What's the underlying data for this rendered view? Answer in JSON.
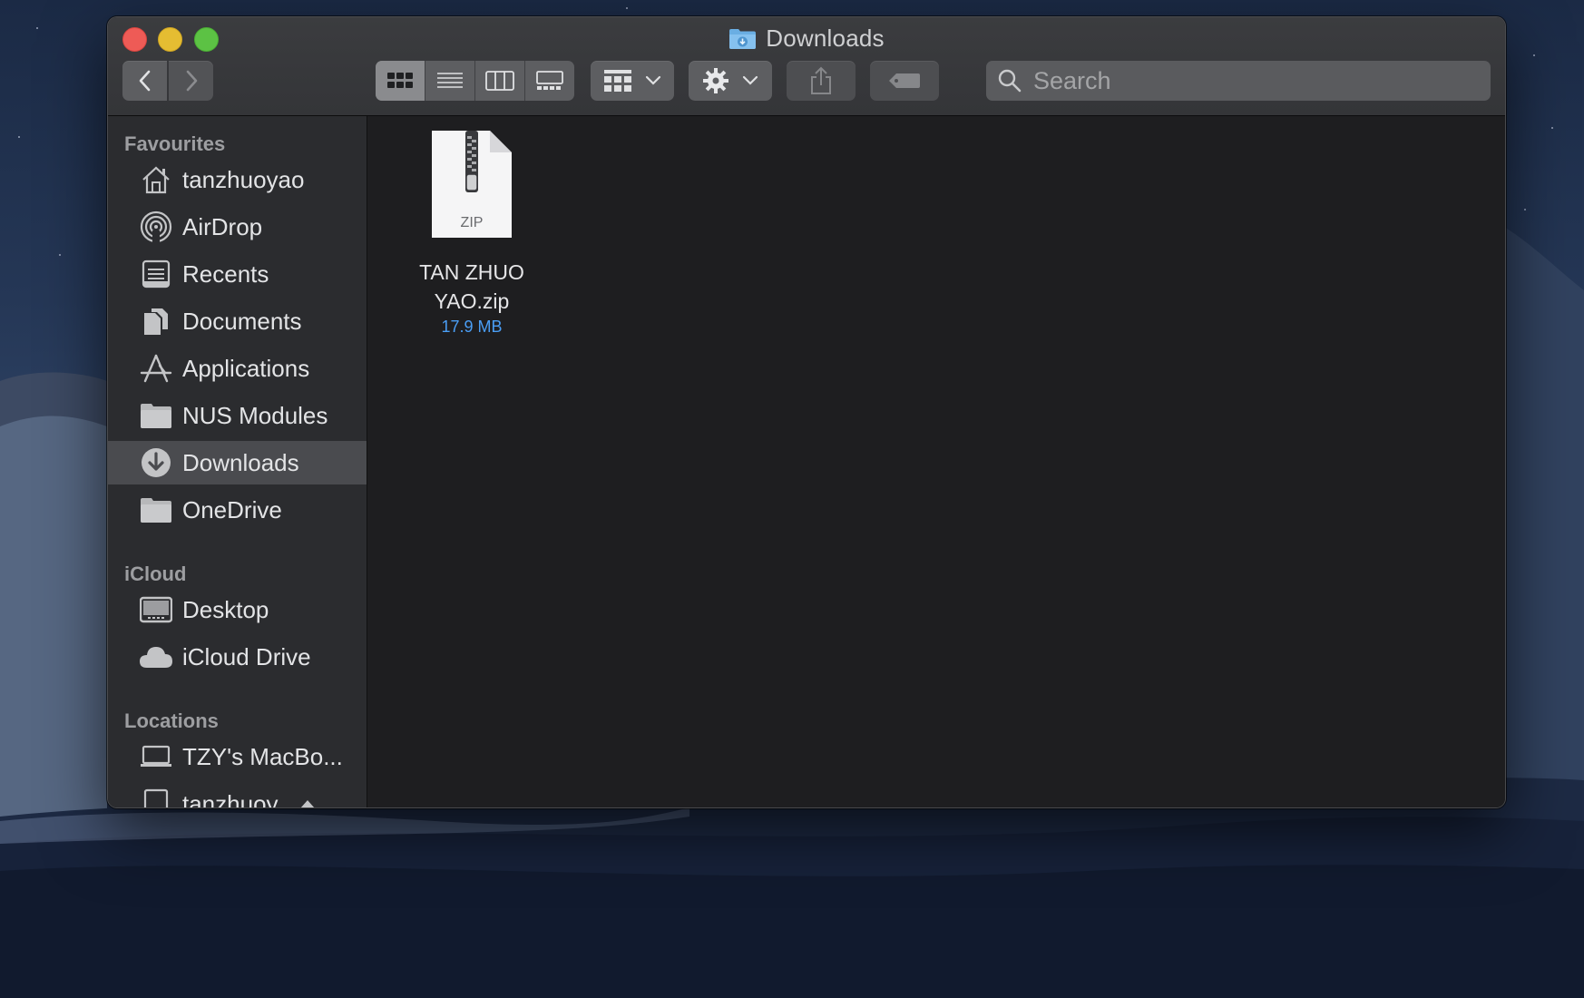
{
  "window": {
    "title": "Downloads"
  },
  "toolbar": {
    "back_label": "Back",
    "forward_label": "Forward",
    "views": [
      "icon-view",
      "list-view",
      "column-view",
      "gallery-view"
    ],
    "active_view": "icon-view",
    "search_placeholder": "Search"
  },
  "sidebar": {
    "sections": [
      {
        "heading": "Favourites",
        "items": [
          {
            "label": "tanzhuoyao",
            "icon": "home-icon"
          },
          {
            "label": "AirDrop",
            "icon": "airdrop-icon"
          },
          {
            "label": "Recents",
            "icon": "recents-icon"
          },
          {
            "label": "Documents",
            "icon": "documents-icon"
          },
          {
            "label": "Applications",
            "icon": "applications-icon"
          },
          {
            "label": "NUS Modules",
            "icon": "folder-icon"
          },
          {
            "label": "Downloads",
            "icon": "downloads-icon",
            "selected": true
          },
          {
            "label": "OneDrive",
            "icon": "folder-icon"
          }
        ]
      },
      {
        "heading": "iCloud",
        "items": [
          {
            "label": "Desktop",
            "icon": "desktop-icon"
          },
          {
            "label": "iCloud Drive",
            "icon": "cloud-icon"
          }
        ]
      },
      {
        "heading": "Locations",
        "items": [
          {
            "label": "TZY's MacBo...",
            "icon": "laptop-icon"
          },
          {
            "label": "tanzhuoy...",
            "icon": "disk-icon",
            "eject": true
          }
        ]
      }
    ]
  },
  "files": [
    {
      "name": "TAN ZHUO YAO.zip",
      "name_line1": "TAN ZHUO",
      "name_line2": "YAO.zip",
      "size": "17.9 MB",
      "badge": "ZIP",
      "icon": "zip-file-icon"
    }
  ],
  "colors": {
    "accent": "#4a9ef5",
    "close": "#ee5b56",
    "minimize": "#e5bd32",
    "maximize": "#5cc244",
    "sidebar_bg": "#2b2c2f",
    "content_bg": "#1e1e20",
    "selection": "#4a4b4f"
  }
}
